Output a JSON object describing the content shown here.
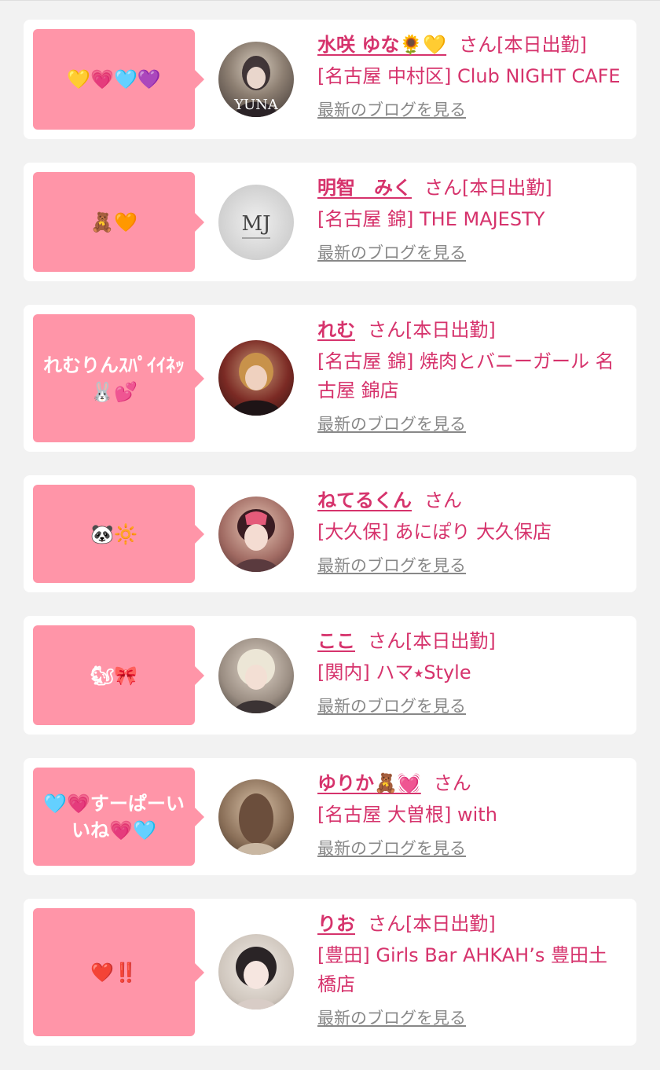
{
  "cards": [
    {
      "bubble": "💛💗🩵💜",
      "name": "水咲 ゆな🌻💛",
      "suffix": "さん[本日出勤]",
      "shop": "[名古屋 中村区] Club NIGHT CAFE",
      "blog": "最新のブログを見る",
      "avatar_text": "YUNA"
    },
    {
      "bubble": "🧸🧡",
      "name": "明智　みく",
      "suffix": "さん[本日出勤]",
      "shop": "[名古屋 錦] THE MAJESTY",
      "blog": "最新のブログを見る",
      "avatar_text": "MJ"
    },
    {
      "bubble": "れむりんｽﾊﾟｲｲﾈｯ🐰💕",
      "name": "れむ",
      "suffix": "さん[本日出勤]",
      "shop": "[名古屋 錦] 焼肉とバニーガール 名古屋 錦店",
      "blog": "最新のブログを見る",
      "avatar_text": ""
    },
    {
      "bubble": "🐼🔆",
      "name": "ねてるくん",
      "suffix": "さん",
      "shop": "[大久保] あにぽり 大久保店",
      "blog": "最新のブログを見る",
      "avatar_text": ""
    },
    {
      "bubble": "🐿🎀",
      "name": "ここ",
      "suffix": "さん[本日出勤]",
      "shop": "[関内] ハマ⭑Style",
      "blog": "最新のブログを見る",
      "avatar_text": ""
    },
    {
      "bubble": "🩵💗すーぱーいいね💗🩵",
      "name": "ゆりか🧸💓",
      "suffix": "さん",
      "shop": "[名古屋 大曽根] with",
      "blog": "最新のブログを見る",
      "avatar_text": ""
    },
    {
      "bubble": "❤️‼️",
      "name": "りお",
      "suffix": "さん[本日出勤]",
      "shop": "[豊田] Girls Bar AHKAH’s 豊田土橋店",
      "blog": "最新のブログを見る",
      "avatar_text": ""
    }
  ]
}
